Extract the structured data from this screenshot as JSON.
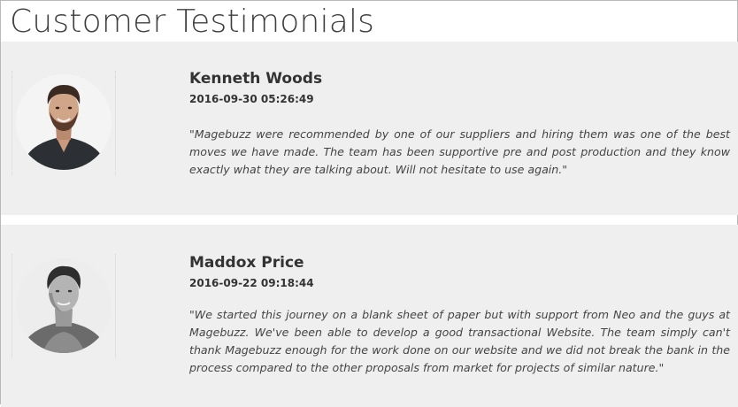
{
  "page": {
    "title": "Customer Testimonials"
  },
  "testimonials": [
    {
      "name": "Kenneth Woods",
      "date": "2016-09-30 05:26:49",
      "quote": "\"Magebuzz were recommended by one of our suppliers and hiring them was one of the best moves we have made. The team has been supportive pre and post production and they know exactly what they are talking about. Will not hesitate to use again.\""
    },
    {
      "name": "Maddox Price",
      "date": "2016-09-22 09:18:44",
      "quote": "\"We started this journey on a blank sheet of paper but with support from Neo and the guys at Magebuzz. We've been able to develop a good transactional Website. The team simply can't thank Magebuzz enough for the work done on our website and we did not break the bank in the process compared to the other proposals from market for projects of similar nature.\""
    }
  ]
}
